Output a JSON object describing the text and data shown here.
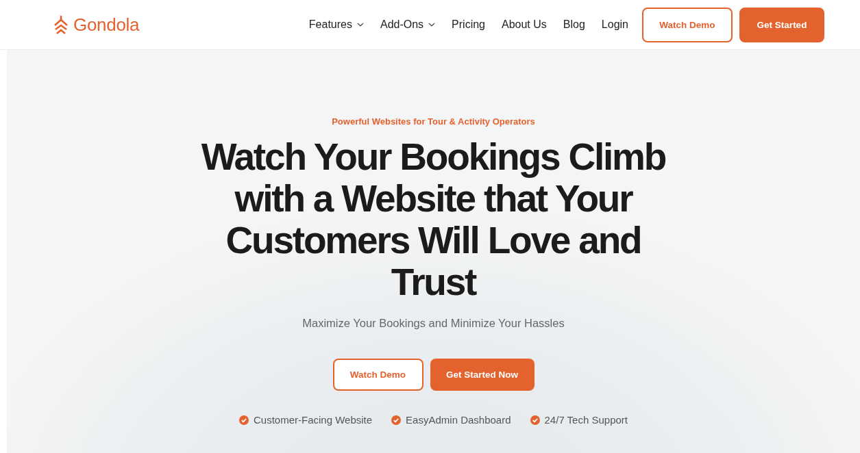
{
  "header": {
    "logo": "Gondola",
    "nav": [
      {
        "label": "Features",
        "kind": "dropdown"
      },
      {
        "label": "Add-Ons",
        "kind": "dropdown"
      },
      {
        "label": "Pricing",
        "kind": "link"
      },
      {
        "label": "About Us",
        "kind": "link"
      },
      {
        "label": "Blog",
        "kind": "link"
      },
      {
        "label": "Login",
        "kind": "link"
      }
    ],
    "buttons": [
      {
        "label": "Watch Demo",
        "kind": "outline"
      },
      {
        "label": "Get Started",
        "kind": "filled"
      }
    ]
  },
  "hero": {
    "eyebrow": "Powerful Websites for Tour & Activity Operators",
    "headline": "Watch Your Bookings Climb with a Website that Your Customers Will Love and Trust",
    "subtitle": "Maximize Your Bookings and Minimize Your Hassles",
    "buttons": [
      {
        "label": "Watch Demo",
        "kind": "outline"
      },
      {
        "label": "Get Started Now",
        "kind": "filled"
      }
    ],
    "features": [
      "Customer-Facing Website",
      "EasyAdmin Dashboard",
      "24/7 Tech Support"
    ]
  }
}
